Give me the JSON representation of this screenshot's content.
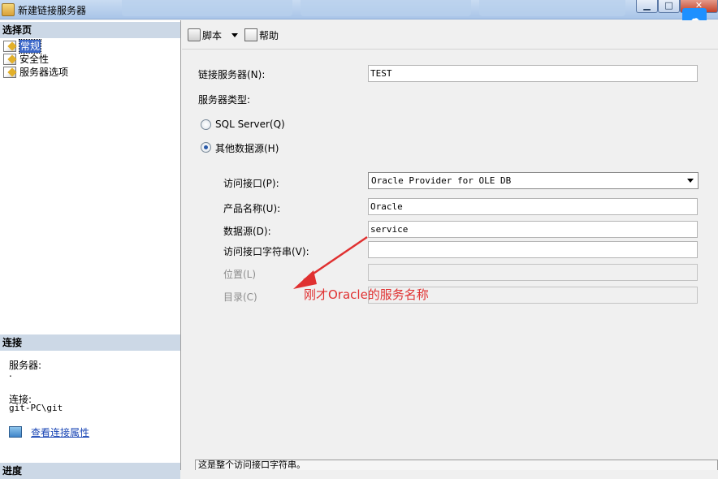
{
  "window": {
    "title": "新建链接服务器",
    "controls": [
      "minimize",
      "maximize",
      "close"
    ]
  },
  "left_panel": {
    "select_page_header": "选择页",
    "pages": [
      {
        "label": "常规",
        "selected": true
      },
      {
        "label": "安全性",
        "selected": false
      },
      {
        "label": "服务器选项",
        "selected": false
      }
    ],
    "connection_header": "连接",
    "server_label": "服务器:",
    "server_value": ".",
    "connection_label": "连接:",
    "connection_value": "git-PC\\git",
    "view_conn_props": "查看连接属性",
    "progress_header": "进度"
  },
  "toolbar": {
    "script_label": "脚本",
    "help_label": "帮助"
  },
  "form": {
    "linked_server_label": "链接服务器(N):",
    "linked_server_value": "TEST",
    "server_type_label": "服务器类型:",
    "radio_sql_server": "SQL Server(Q)",
    "radio_other": "其他数据源(H)",
    "selected_server_type": "other",
    "provider_label": "访问接口(P):",
    "provider_value": "Oracle Provider for OLE DB",
    "product_name_label": "产品名称(U):",
    "product_name_value": "Oracle",
    "data_source_label": "数据源(D):",
    "data_source_value": "service",
    "provider_string_label": "访问接口字符串(V):",
    "provider_string_value": "",
    "location_label": "位置(L)",
    "location_value": "",
    "catalog_label": "目录(C)",
    "catalog_value": ""
  },
  "annotation": {
    "text": "刚才Oracle的服务名称",
    "color": "#e03030"
  },
  "description": {
    "text": "这是整个访问接口字符串。"
  },
  "colors": {
    "section_header": "#ccd8e6",
    "selection": "#3a66c8",
    "link": "#1a46b5"
  }
}
